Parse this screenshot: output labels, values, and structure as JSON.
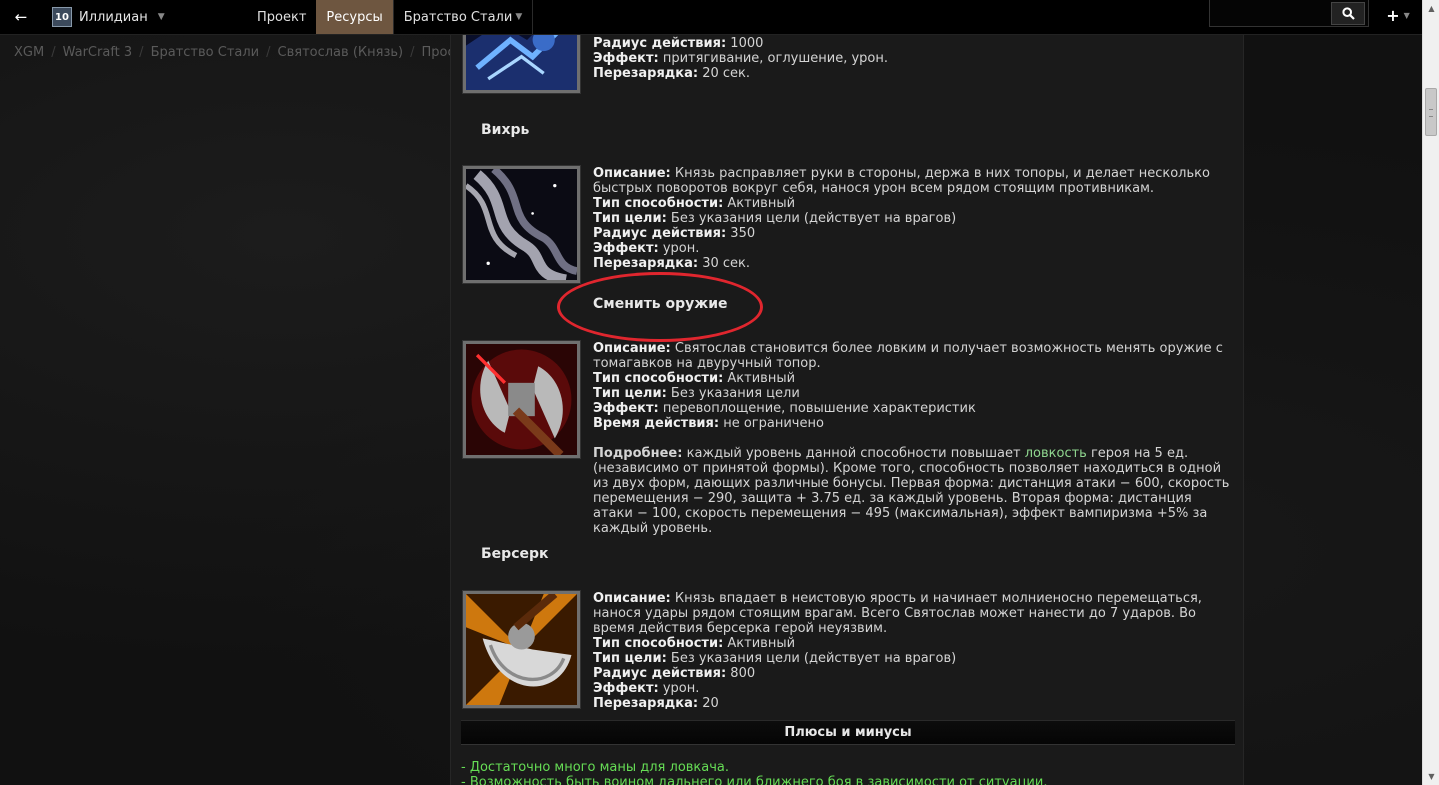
{
  "topbar": {
    "back_icon": "←",
    "user_name": "Иллидиан",
    "avatar_text": "10",
    "nav": [
      "Проект",
      "Ресурсы",
      "Братство Стали"
    ],
    "search_placeholder": "",
    "plus_icon": "+"
  },
  "breadcrumb": [
    "XGM",
    "WarCraft 3",
    "Братство Стали",
    "Святослав (Князь)",
    "Просм"
  ],
  "abilities": {
    "top": {
      "radius_label": "Радиус действия:",
      "radius_value": " 1000",
      "effect_label": "Эффект:",
      "effect_value": " притягивание, оглушение, урон.",
      "cd_label": "Перезарядка:",
      "cd_value": " 20 сек."
    },
    "vortex": {
      "title": "Вихрь",
      "desc_label": "Описание:",
      "desc_value": " Князь расправляет руки в стороны, держа в них топоры, и делает несколько быстрых поворотов вокруг себя, нанося урон всем рядом стоящим противникам.",
      "type_label": "Тип способности:",
      "type_value": " Активный",
      "target_label": "Тип цели:",
      "target_value": " Без указания цели (действует на врагов)",
      "radius_label": "Радиус действия:",
      "radius_value": " 350",
      "effect_label": "Эффект:",
      "effect_value": " урон.",
      "cd_label": "Перезарядка:",
      "cd_value": " 30 сек."
    },
    "weapon": {
      "title": "Сменить оружие",
      "desc_label": "Описание:",
      "desc_value": " Святослав становится более ловким и получает возможность менять оружие с томагавков на двуручный топор.",
      "type_label": "Тип способности:",
      "type_value": " Активный",
      "target_label": "Тип цели:",
      "target_value": " Без указания цели",
      "effect_label": "Эффект:",
      "effect_value": " перевоплощение, повышение характеристик",
      "time_label": "Время действия:",
      "time_value": " не ограничено",
      "more_label": "Подробнее:",
      "more_pre": " каждый уровень данной способности повышает ",
      "more_link": "ловкость",
      "more_post": " героя на 5 ед. (независимо от принятой формы). Кроме того, способность позволяет находиться в одной из двух форм, дающих различные бонусы. Первая форма: дистанция атаки − 600, скорость перемещения − 290, защита + 3.75 ед. за каждый уровень. Вторая форма: дистанция атаки − 100, скорость перемещения − 495 (максимальная), эффект вампиризма +5% за каждый уровень."
    },
    "berserk": {
      "title": "Берсерк",
      "desc_label": "Описание:",
      "desc_value": " Князь впадает в неистовую ярость и начинает молниеносно перемещаться, нанося удары рядом стоящим врагам. Всего Святослав может нанести до 7 ударов. Во время действия берсерка герой неуязвим.",
      "type_label": "Тип способности:",
      "type_value": " Активный",
      "target_label": "Тип цели:",
      "target_value": " Без указания цели (действует на врагов)",
      "radius_label": "Радиус действия:",
      "radius_value": " 800",
      "effect_label": "Эффект:",
      "effect_value": " урон.",
      "cd_label": "Перезарядка:",
      "cd_value": " 20"
    }
  },
  "pros_cons": {
    "header": "Плюсы и минусы",
    "items": [
      "- Достаточно много маны для ловкача.",
      "- Возможность быть воином дальнего или ближнего боя в зависимости от ситуации."
    ]
  },
  "colors": {
    "accent_nav": "#6e5640",
    "highlight_ellipse": "#e0262e",
    "green_text": "#66dd55"
  }
}
